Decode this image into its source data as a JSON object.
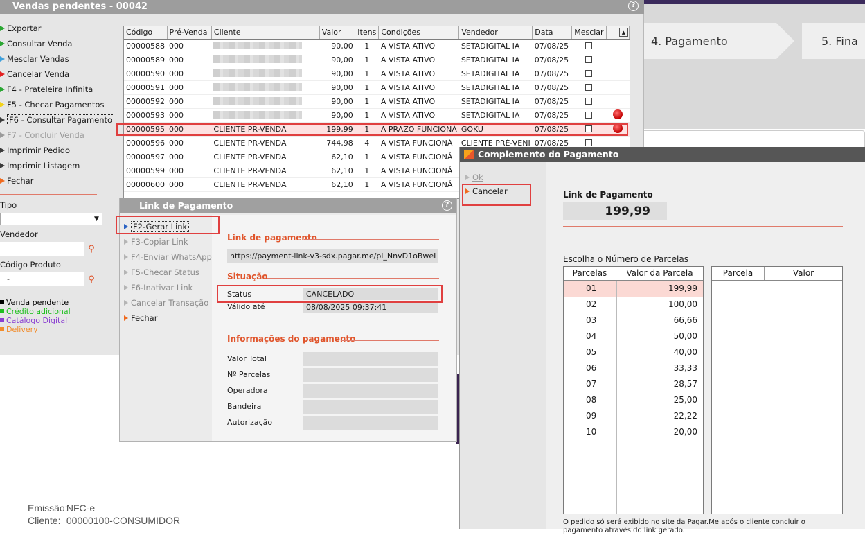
{
  "web": {
    "steps": [
      "4. Pagamento",
      "5. Fina"
    ],
    "emissao_label": "Emissão:",
    "emissao_value": "NFC-e",
    "cliente_label": "Cliente:",
    "cliente_value": "00000100-CONSUMIDOR"
  },
  "vendas": {
    "title": "Vendas pendentes - 00042",
    "menu": [
      {
        "label": "Exportar",
        "color": "#2aa632"
      },
      {
        "label": "Consultar Venda",
        "color": "#2aa632"
      },
      {
        "label": "Mesclar Vendas",
        "color": "#3fa0dc"
      },
      {
        "label": "Cancelar Venda",
        "color": "#e32020"
      },
      {
        "label": "F4 - Prateleira Infinita",
        "color": "#2aa632"
      },
      {
        "label": "F5 - Checar Pagamentos",
        "color": "#f2d21a"
      },
      {
        "label": "F6 - Consultar Pagamento",
        "color": "#3b3b3b"
      },
      {
        "label": "F7 - Concluir Venda",
        "color": "#9a9a9a"
      },
      {
        "label": "Imprimir Pedido",
        "color": "#3b3b3b"
      },
      {
        "label": "Imprimir Listagem",
        "color": "#3b3b3b"
      },
      {
        "label": "Fechar",
        "color": "#f06a1e"
      }
    ],
    "tipo_label": "Tipo",
    "vendedor_label": "Vendedor",
    "codigo_produto_label": "Código Produto",
    "codigo_produto_value": "-",
    "legend": [
      {
        "label": "Venda pendente",
        "color": "#000000"
      },
      {
        "label": "Crédito adicional",
        "color": "#1fbf1f"
      },
      {
        "label": "Catálogo Digital",
        "color": "#8a3fd1"
      },
      {
        "label": "Delivery",
        "color": "#f28c2b"
      }
    ],
    "columns": [
      "Código",
      "Pré-Venda",
      "Cliente",
      "Valor",
      "Itens",
      "Condições",
      "Vendedor",
      "Data",
      "Mesclar"
    ],
    "rows": [
      {
        "codigo": "00000588",
        "pre": "000",
        "cliente": "",
        "valor": "90,00",
        "itens": "1",
        "cond": "A VISTA ATIVO",
        "vend": "SETADIGITAL IA",
        "data": "07/08/25",
        "dot": false
      },
      {
        "codigo": "00000589",
        "pre": "000",
        "cliente": "",
        "valor": "90,00",
        "itens": "1",
        "cond": "A VISTA ATIVO",
        "vend": "SETADIGITAL IA",
        "data": "07/08/25",
        "dot": false
      },
      {
        "codigo": "00000590",
        "pre": "000",
        "cliente": "",
        "valor": "90,00",
        "itens": "1",
        "cond": "A VISTA ATIVO",
        "vend": "SETADIGITAL IA",
        "data": "07/08/25",
        "dot": false
      },
      {
        "codigo": "00000591",
        "pre": "000",
        "cliente": "",
        "valor": "90,00",
        "itens": "1",
        "cond": "A VISTA ATIVO",
        "vend": "SETADIGITAL IA",
        "data": "07/08/25",
        "dot": false
      },
      {
        "codigo": "00000592",
        "pre": "000",
        "cliente": "",
        "valor": "90,00",
        "itens": "1",
        "cond": "A VISTA ATIVO",
        "vend": "SETADIGITAL IA",
        "data": "07/08/25",
        "dot": false
      },
      {
        "codigo": "00000593",
        "pre": "000",
        "cliente": "",
        "valor": "90,00",
        "itens": "1",
        "cond": "A VISTA ATIVO",
        "vend": "SETADIGITAL IA",
        "data": "07/08/25",
        "dot": true
      },
      {
        "codigo": "00000595",
        "pre": "000",
        "cliente": "CLIENTE PR-VENDA",
        "valor": "199,99",
        "itens": "1",
        "cond": "A PRAZO FUNCIONÁ",
        "vend": "GOKU",
        "data": "07/08/25",
        "dot": true
      },
      {
        "codigo": "00000596",
        "pre": "000",
        "cliente": "CLIENTE PR-VENDA",
        "valor": "744,98",
        "itens": "4",
        "cond": "A VISTA FUNCIONÁ",
        "vend": "CLIENTE PRÉ-VENI",
        "data": "07/08/25",
        "dot": false
      },
      {
        "codigo": "00000597",
        "pre": "000",
        "cliente": "CLIENTE PR-VENDA",
        "valor": "62,10",
        "itens": "1",
        "cond": "A VISTA FUNCIONÁ",
        "vend": "",
        "data": "",
        "dot": false
      },
      {
        "codigo": "00000599",
        "pre": "000",
        "cliente": "CLIENTE PR-VENDA",
        "valor": "62,10",
        "itens": "1",
        "cond": "A VISTA FUNCIONÁ",
        "vend": "",
        "data": "",
        "dot": false
      },
      {
        "codigo": "00000600",
        "pre": "000",
        "cliente": "CLIENTE PR-VENDA",
        "valor": "62,10",
        "itens": "1",
        "cond": "A VISTA FUNCIONÁ",
        "vend": "",
        "data": "",
        "dot": false
      }
    ]
  },
  "link": {
    "title": "Link de Pagamento",
    "menu": [
      "F2-Gerar Link",
      "F3-Copiar Link",
      "F4-Enviar WhatsApp",
      "F5-Checar Status",
      "F6-Inativar Link",
      "Cancelar Transação",
      "Fechar"
    ],
    "link_header": "Link de pagamento",
    "link_url": "https://payment-link-v3-sdx.pagar.me/pl_NnvD1oBweL",
    "situacao_header": "Situação",
    "status_label": "Status",
    "status_value": "CANCELADO",
    "valido_label": "Válido até",
    "valido_value": "08/08/2025 09:37:41",
    "info_header": "Informações do pagamento",
    "info_fields": [
      "Valor Total",
      "Nº Parcelas",
      "Operadora",
      "Bandeira",
      "Autorização"
    ]
  },
  "complemento": {
    "title": "Complemento do Pagamento",
    "menu": [
      "Ok",
      "Cancelar"
    ],
    "link_label": "Link de Pagamento",
    "link_value": "199,99",
    "escolha_label": "Escolha o Número de Parcelas",
    "col_parcelas": "Parcelas",
    "col_valor_parcela": "Valor da Parcela",
    "col_parcela": "Parcela",
    "col_valor": "Valor",
    "parcelas": [
      {
        "n": "01",
        "v": "199,99"
      },
      {
        "n": "02",
        "v": "100,00"
      },
      {
        "n": "03",
        "v": "66,66"
      },
      {
        "n": "04",
        "v": "50,00"
      },
      {
        "n": "05",
        "v": "40,00"
      },
      {
        "n": "06",
        "v": "33,33"
      },
      {
        "n": "07",
        "v": "28,57"
      },
      {
        "n": "08",
        "v": "25,00"
      },
      {
        "n": "09",
        "v": "22,22"
      },
      {
        "n": "10",
        "v": "20,00"
      }
    ],
    "note": "O pedido só será exibido no site da Pagar.Me após o cliente concluir o pagamento através do link gerado."
  }
}
